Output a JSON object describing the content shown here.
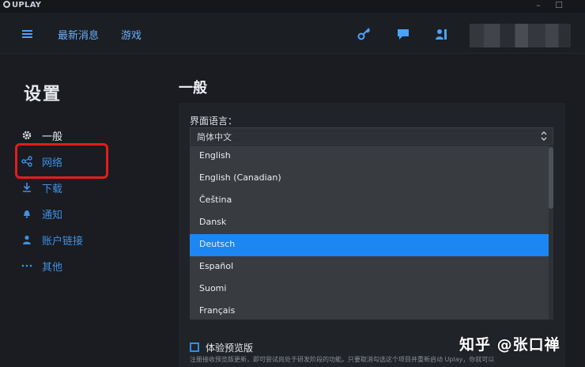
{
  "app": {
    "logo_text": "UPLAY",
    "window_controls": [
      "minimize-icon",
      "maximize-icon"
    ]
  },
  "topnav": {
    "menu_icon": "hamburger-icon",
    "links": [
      "最新消息",
      "游戏"
    ],
    "icons": [
      "key-icon",
      "chat-icon",
      "friends-icon"
    ]
  },
  "sidebar": {
    "title": "设置",
    "items": [
      {
        "label": "一般",
        "icon": "gear-icon"
      },
      {
        "label": "网络",
        "icon": "network-icon"
      },
      {
        "label": "下载",
        "icon": "download-icon"
      },
      {
        "label": "通知",
        "icon": "bell-icon"
      },
      {
        "label": "账户链接",
        "icon": "user-icon"
      },
      {
        "label": "其他",
        "icon": "more-icon"
      }
    ]
  },
  "main": {
    "section_title": "一般",
    "language_label": "界面语言：",
    "language_selected": "简体中文",
    "language_options": [
      "English",
      "English (Canadian)",
      "Čeština",
      "Dansk",
      "Deutsch",
      "Español",
      "Suomi",
      "Français"
    ],
    "highlighted_option": "Deutsch",
    "preview_checkbox_label": "体验预览版",
    "preview_checkbox_checked": false,
    "preview_description": "注册接收预览版更新，即可尝试尚处于研发阶段的功能。只要取消勾选这个项目并重新启动 Uplay，你就可以"
  },
  "overlay": {
    "watermark": "知乎 @张口禅"
  },
  "colors": {
    "accent": "#1c86f2",
    "link": "#6ab0ff",
    "annotation": "#e21d1d"
  }
}
